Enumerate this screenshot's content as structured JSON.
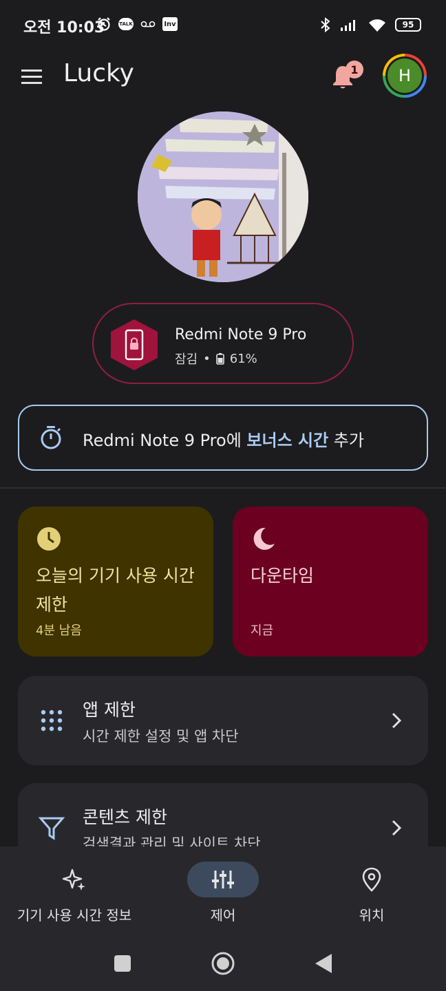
{
  "status_bar": {
    "time_prefix": "오전",
    "time": "10:03",
    "icons": [
      "alarm-icon",
      "kakaotalk-icon",
      "voicemail-icon",
      "inv-icon",
      "bluetooth-icon",
      "signal-icon",
      "wifi-icon",
      "battery-icon"
    ],
    "talk_label": "TALK",
    "inv_label": "Inv",
    "battery_level": "95"
  },
  "header": {
    "title": "Lucky",
    "notification_count": "1",
    "avatar_letter": "H"
  },
  "device": {
    "name": "Redmi Note 9 Pro",
    "state": "잠김",
    "separator": "•",
    "battery": "61%"
  },
  "bonus": {
    "prefix": "Redmi Note 9 Pro에 ",
    "highlight": "보너스 시간",
    "suffix": " 추가"
  },
  "cards": {
    "screen_time": {
      "title": "오늘의 기기 사용 시간 제한",
      "subtitle": "4분 남음"
    },
    "downtime": {
      "title": "다운타임",
      "subtitle": "지금"
    }
  },
  "rows": {
    "app_limits": {
      "title": "앱 제한",
      "subtitle": "시간 제한 설정 및 앱 차단"
    },
    "content_limits": {
      "title": "콘텐츠 제한",
      "subtitle": "검색결과 관리 및 사이트 차단"
    }
  },
  "bottom_nav": {
    "items": [
      {
        "label": "기기 사용 시간 정보",
        "icon": "sparkle-icon"
      },
      {
        "label": "제어",
        "icon": "sliders-icon",
        "active": true
      },
      {
        "label": "위치",
        "icon": "location-icon"
      }
    ]
  },
  "colors": {
    "background": "#1c1c1e",
    "accent_blue": "#aacbf2",
    "card_yellow": "#3f3300",
    "card_red": "#6b0020",
    "device_border": "#8f1f3e"
  }
}
